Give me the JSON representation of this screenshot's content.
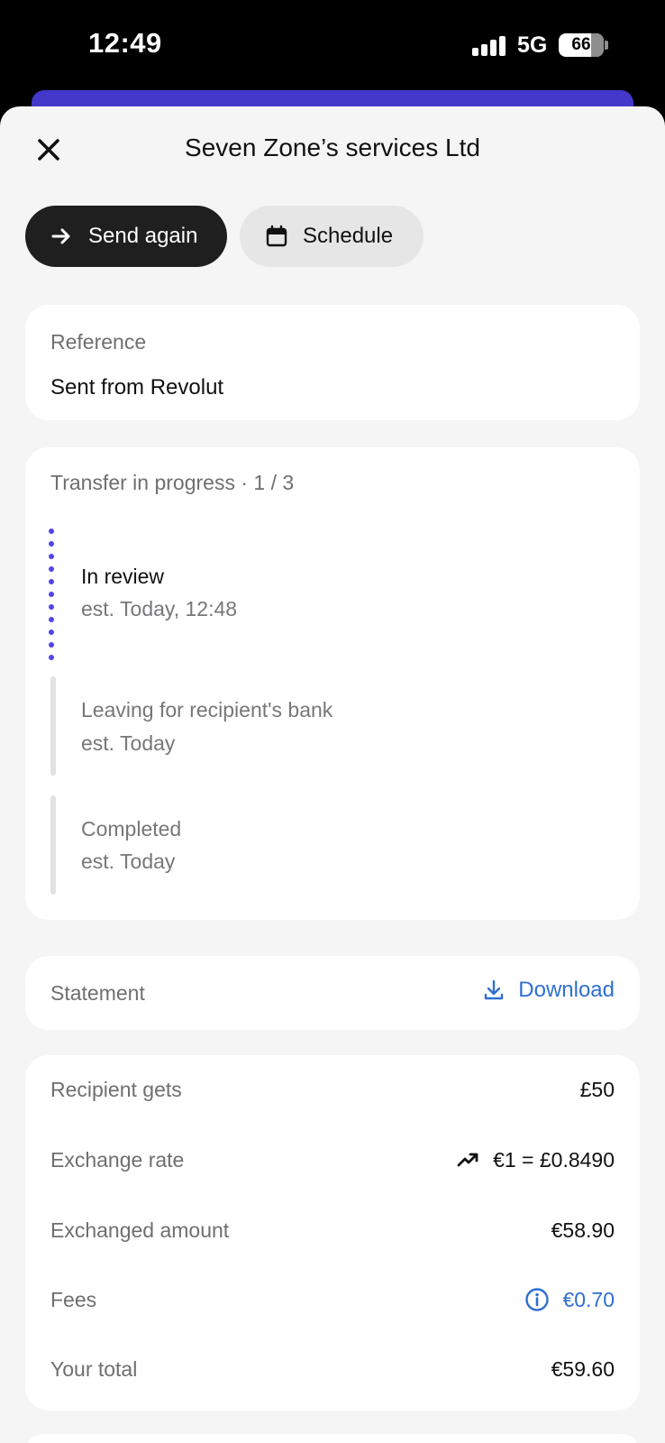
{
  "status_bar": {
    "time": "12:49",
    "network": "5G",
    "battery": "66"
  },
  "header": {
    "title": "Seven Zone’s services Ltd",
    "close_icon": "close-icon"
  },
  "actions": {
    "send_again_label": "Send again",
    "send_again_icon": "arrow-right-icon",
    "schedule_label": "Schedule",
    "schedule_icon": "calendar-icon"
  },
  "reference": {
    "label": "Reference",
    "value": "Sent from Revolut"
  },
  "progress": {
    "header": "Transfer in progress · 1 / 3",
    "current_step": 1,
    "total_steps": 3,
    "accent_color": "#4f46e5",
    "steps": [
      {
        "title": "In review",
        "subtitle": "est. Today, 12:48",
        "active": true
      },
      {
        "title": "Leaving for recipient's bank",
        "subtitle": "est. Today",
        "active": false
      },
      {
        "title": "Completed",
        "subtitle": "est. Today",
        "active": false
      }
    ]
  },
  "statement": {
    "label": "Statement",
    "action_label": "Download",
    "action_icon": "download-icon",
    "link_color": "#2f6fd1"
  },
  "details": {
    "rows": [
      {
        "label": "Recipient gets",
        "value": "£50"
      },
      {
        "label": "Exchange rate",
        "value": "€1 = £0.8490",
        "icon": "trend-up-icon"
      },
      {
        "label": "Exchanged amount",
        "value": "€58.90"
      },
      {
        "label": "Fees",
        "value": "€0.70",
        "icon": "info-icon"
      },
      {
        "label": "Your total",
        "value": "€59.60"
      }
    ]
  }
}
